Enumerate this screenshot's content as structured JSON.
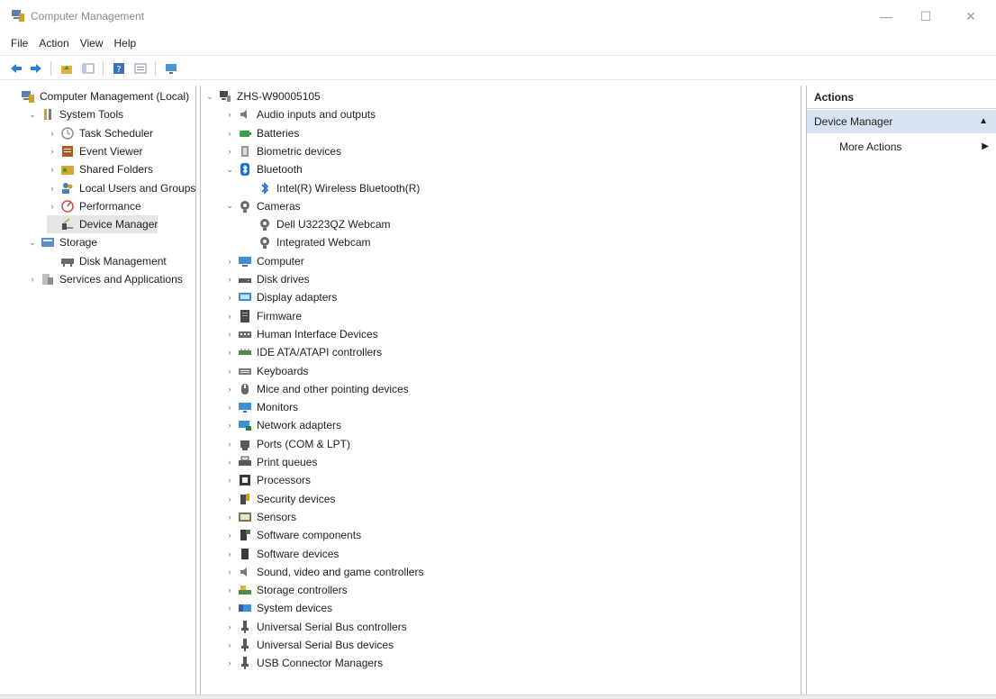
{
  "window": {
    "title": "Computer Management",
    "minimize_glyph": "—",
    "maximize_glyph": "☐",
    "close_glyph": "✕"
  },
  "menubar": [
    "File",
    "Action",
    "View",
    "Help"
  ],
  "toolbar": [
    "back-arrow-icon",
    "forward-arrow-icon",
    "up-folder-icon",
    "show-hide-tree-icon",
    "help-icon",
    "properties-icon",
    "monitor-icon"
  ],
  "left_tree": [
    {
      "label": "Computer Management (Local)",
      "icon": "computer-management-icon",
      "depth": 0,
      "expander": "none",
      "color": "#5a7fb5"
    },
    {
      "label": "System Tools",
      "icon": "tools-icon",
      "depth": 1,
      "expander": "expanded",
      "color": "#c9a227"
    },
    {
      "label": "Task Scheduler",
      "icon": "clock-icon",
      "depth": 2,
      "expander": "collapsed",
      "color": "#8e8e8e"
    },
    {
      "label": "Event Viewer",
      "icon": "event-viewer-icon",
      "depth": 2,
      "expander": "collapsed",
      "color": "#b05a2a"
    },
    {
      "label": "Shared Folders",
      "icon": "shared-folder-icon",
      "depth": 2,
      "expander": "collapsed",
      "color": "#d9a52b"
    },
    {
      "label": "Local Users and Groups",
      "icon": "users-icon",
      "depth": 2,
      "expander": "collapsed",
      "color": "#4f7db8"
    },
    {
      "label": "Performance",
      "icon": "performance-icon",
      "depth": 2,
      "expander": "collapsed",
      "color": "#d14b3b"
    },
    {
      "label": "Device Manager",
      "icon": "device-manager-icon",
      "depth": 2,
      "expander": "none",
      "selected": true,
      "color": "#4a4a4a"
    },
    {
      "label": "Storage",
      "icon": "storage-icon",
      "depth": 1,
      "expander": "expanded",
      "color": "#5b8fc6"
    },
    {
      "label": "Disk Management",
      "icon": "disk-management-icon",
      "depth": 2,
      "expander": "none",
      "color": "#6a6a6a"
    },
    {
      "label": "Services and Applications",
      "icon": "services-icon",
      "depth": 1,
      "expander": "collapsed",
      "color": "#8c8c8c"
    }
  ],
  "device_tree": [
    {
      "label": "ZHS-W90005105",
      "icon": "computer-root-icon",
      "depth": 0,
      "expander": "expanded",
      "color": "#4a4a4a"
    },
    {
      "label": "Audio inputs and outputs",
      "icon": "speaker-icon",
      "depth": 1,
      "expander": "collapsed",
      "color": "#7a7a7a"
    },
    {
      "label": "Batteries",
      "icon": "battery-icon",
      "depth": 1,
      "expander": "collapsed",
      "color": "#3f9e4a"
    },
    {
      "label": "Biometric devices",
      "icon": "biometric-icon",
      "depth": 1,
      "expander": "collapsed",
      "color": "#9a9a9a"
    },
    {
      "label": "Bluetooth",
      "icon": "bluetooth-icon",
      "depth": 1,
      "expander": "expanded",
      "color": "#1e6fd9"
    },
    {
      "label": "Intel(R) Wireless Bluetooth(R)",
      "icon": "bluetooth-device-icon",
      "depth": 2,
      "expander": "none",
      "color": "#1e6fd9"
    },
    {
      "label": "Cameras",
      "icon": "camera-icon",
      "depth": 1,
      "expander": "expanded",
      "color": "#6a6a6a"
    },
    {
      "label": "Dell U3223QZ Webcam",
      "icon": "webcam-icon",
      "depth": 2,
      "expander": "none",
      "color": "#6a6a6a"
    },
    {
      "label": "Integrated Webcam",
      "icon": "webcam-icon",
      "depth": 2,
      "expander": "none",
      "color": "#6a6a6a"
    },
    {
      "label": "Computer",
      "icon": "computer-icon",
      "depth": 1,
      "expander": "collapsed",
      "color": "#3a8fd6"
    },
    {
      "label": "Disk drives",
      "icon": "disk-drive-icon",
      "depth": 1,
      "expander": "collapsed",
      "color": "#5a5a5a"
    },
    {
      "label": "Display adapters",
      "icon": "display-adapter-icon",
      "depth": 1,
      "expander": "collapsed",
      "color": "#3a8fd6"
    },
    {
      "label": "Firmware",
      "icon": "firmware-icon",
      "depth": 1,
      "expander": "collapsed",
      "color": "#4a4a4a"
    },
    {
      "label": "Human Interface Devices",
      "icon": "hid-icon",
      "depth": 1,
      "expander": "collapsed",
      "color": "#6a6a6a"
    },
    {
      "label": "IDE ATA/ATAPI controllers",
      "icon": "ide-controller-icon",
      "depth": 1,
      "expander": "collapsed",
      "color": "#4a8a4a"
    },
    {
      "label": "Keyboards",
      "icon": "keyboard-icon",
      "depth": 1,
      "expander": "collapsed",
      "color": "#7a7a7a"
    },
    {
      "label": "Mice and other pointing devices",
      "icon": "mouse-icon",
      "depth": 1,
      "expander": "collapsed",
      "color": "#6a6a6a"
    },
    {
      "label": "Monitors",
      "icon": "monitor-icon",
      "depth": 1,
      "expander": "collapsed",
      "color": "#3a8fd6"
    },
    {
      "label": "Network adapters",
      "icon": "network-adapter-icon",
      "depth": 1,
      "expander": "collapsed",
      "color": "#3a8fd6"
    },
    {
      "label": "Ports (COM & LPT)",
      "icon": "port-icon",
      "depth": 1,
      "expander": "collapsed",
      "color": "#5a5a5a"
    },
    {
      "label": "Print queues",
      "icon": "printer-icon",
      "depth": 1,
      "expander": "collapsed",
      "color": "#5a5a5a"
    },
    {
      "label": "Processors",
      "icon": "processor-icon",
      "depth": 1,
      "expander": "collapsed",
      "color": "#3a3a3a"
    },
    {
      "label": "Security devices",
      "icon": "security-device-icon",
      "depth": 1,
      "expander": "collapsed",
      "color": "#c9a227"
    },
    {
      "label": "Sensors",
      "icon": "sensor-icon",
      "depth": 1,
      "expander": "collapsed",
      "color": "#6a7a4a"
    },
    {
      "label": "Software components",
      "icon": "software-component-icon",
      "depth": 1,
      "expander": "collapsed",
      "color": "#4a7a3a"
    },
    {
      "label": "Software devices",
      "icon": "software-device-icon",
      "depth": 1,
      "expander": "collapsed",
      "color": "#3a3a3a"
    },
    {
      "label": "Sound, video and game controllers",
      "icon": "speaker-icon",
      "depth": 1,
      "expander": "collapsed",
      "color": "#7a7a7a"
    },
    {
      "label": "Storage controllers",
      "icon": "storage-controller-icon",
      "depth": 1,
      "expander": "collapsed",
      "color": "#4a8a4a"
    },
    {
      "label": "System devices",
      "icon": "system-device-icon",
      "depth": 1,
      "expander": "collapsed",
      "color": "#3a8fd6"
    },
    {
      "label": "Universal Serial Bus controllers",
      "icon": "usb-icon",
      "depth": 1,
      "expander": "collapsed",
      "color": "#5a5a5a"
    },
    {
      "label": "Universal Serial Bus devices",
      "icon": "usb-icon",
      "depth": 1,
      "expander": "collapsed",
      "color": "#5a5a5a"
    },
    {
      "label": "USB Connector Managers",
      "icon": "usb-icon",
      "depth": 1,
      "expander": "collapsed",
      "color": "#5a5a5a"
    }
  ],
  "actions": {
    "header": "Actions",
    "section_label": "Device Manager",
    "section_caret": "▲",
    "more_actions_label": "More Actions",
    "more_actions_arrow": "▶"
  },
  "expander_glyphs": {
    "expanded": "⌄",
    "collapsed": "›"
  },
  "colors": {
    "accent_selection": "#d7e3f1",
    "tree_selection": "#e5e5e5"
  }
}
